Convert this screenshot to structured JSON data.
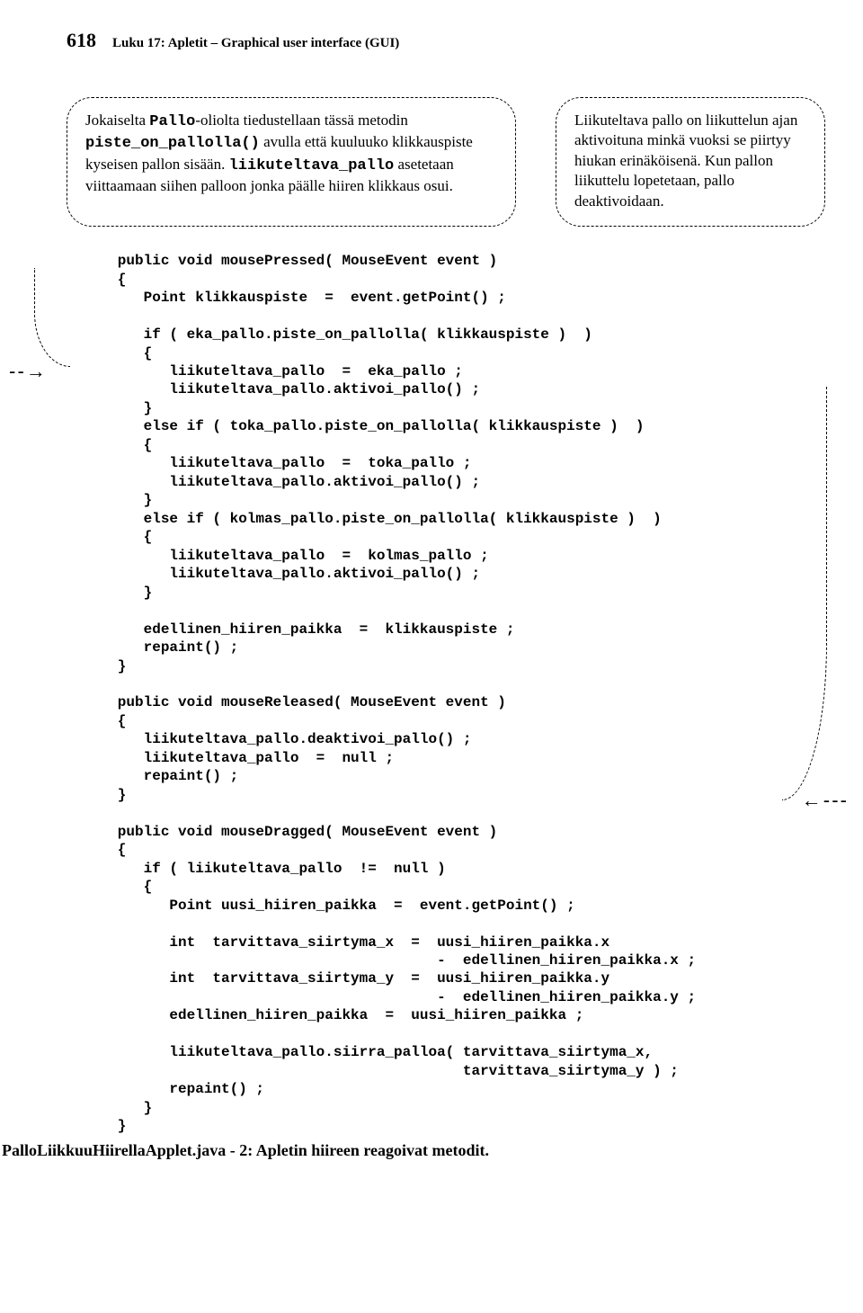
{
  "header": {
    "page_num": "618",
    "chapter": "Luku 17: Apletit – Graphical user interface (GUI)"
  },
  "callouts": {
    "left": {
      "t1": "Jokaiselta ",
      "c1": "Pallo",
      "t2": "-oliolta tiedustellaan tässä metodin ",
      "c2": "piste_on_pallolla()",
      "t3": " avulla että kuuluuko klikkauspiste kyseisen pallon sisään. ",
      "c3": "liikuteltava_pallo",
      "t4": " asetetaan viittaamaan siihen palloon jonka päälle hiiren klikkaus osui."
    },
    "right": "Liikuteltava pallo on liikuttelun ajan aktivoituna minkä vuoksi se piirtyy hiukan erinäköisenä. Kun pallon liikuttelu lopetetaan, pallo deaktivoidaan."
  },
  "code": "   public void mousePressed( MouseEvent event )\n   {\n      Point klikkauspiste  =  event.getPoint() ;\n\n      if ( eka_pallo.piste_on_pallolla( klikkauspiste )  )\n      {\n         liikuteltava_pallo  =  eka_pallo ;\n         liikuteltava_pallo.aktivoi_pallo() ;\n      }\n      else if ( toka_pallo.piste_on_pallolla( klikkauspiste )  )\n      {\n         liikuteltava_pallo  =  toka_pallo ;\n         liikuteltava_pallo.aktivoi_pallo() ;\n      }\n      else if ( kolmas_pallo.piste_on_pallolla( klikkauspiste )  )\n      {\n         liikuteltava_pallo  =  kolmas_pallo ;\n         liikuteltava_pallo.aktivoi_pallo() ;\n      }\n\n      edellinen_hiiren_paikka  =  klikkauspiste ;\n      repaint() ;\n   }\n\n   public void mouseReleased( MouseEvent event )\n   {\n      liikuteltava_pallo.deaktivoi_pallo() ;\n      liikuteltava_pallo  =  null ;\n      repaint() ;\n   }\n\n   public void mouseDragged( MouseEvent event )\n   {\n      if ( liikuteltava_pallo  !=  null )\n      {\n         Point uusi_hiiren_paikka  =  event.getPoint() ;\n\n         int  tarvittava_siirtyma_x  =  uusi_hiiren_paikka.x\n                                        -  edellinen_hiiren_paikka.x ;\n         int  tarvittava_siirtyma_y  =  uusi_hiiren_paikka.y\n                                        -  edellinen_hiiren_paikka.y ;\n         edellinen_hiiren_paikka  =  uusi_hiiren_paikka ;\n\n         liikuteltava_pallo.siirra_palloa( tarvittava_siirtyma_x,\n                                           tarvittava_siirtyma_y ) ;\n         repaint() ;\n      }\n   }",
  "caption": "PalloLiikkuuHiirellaApplet.java - 2:  Apletin hiireen reagoivat metodit.",
  "arrows": {
    "left": "- - →",
    "right": "← - - -"
  }
}
